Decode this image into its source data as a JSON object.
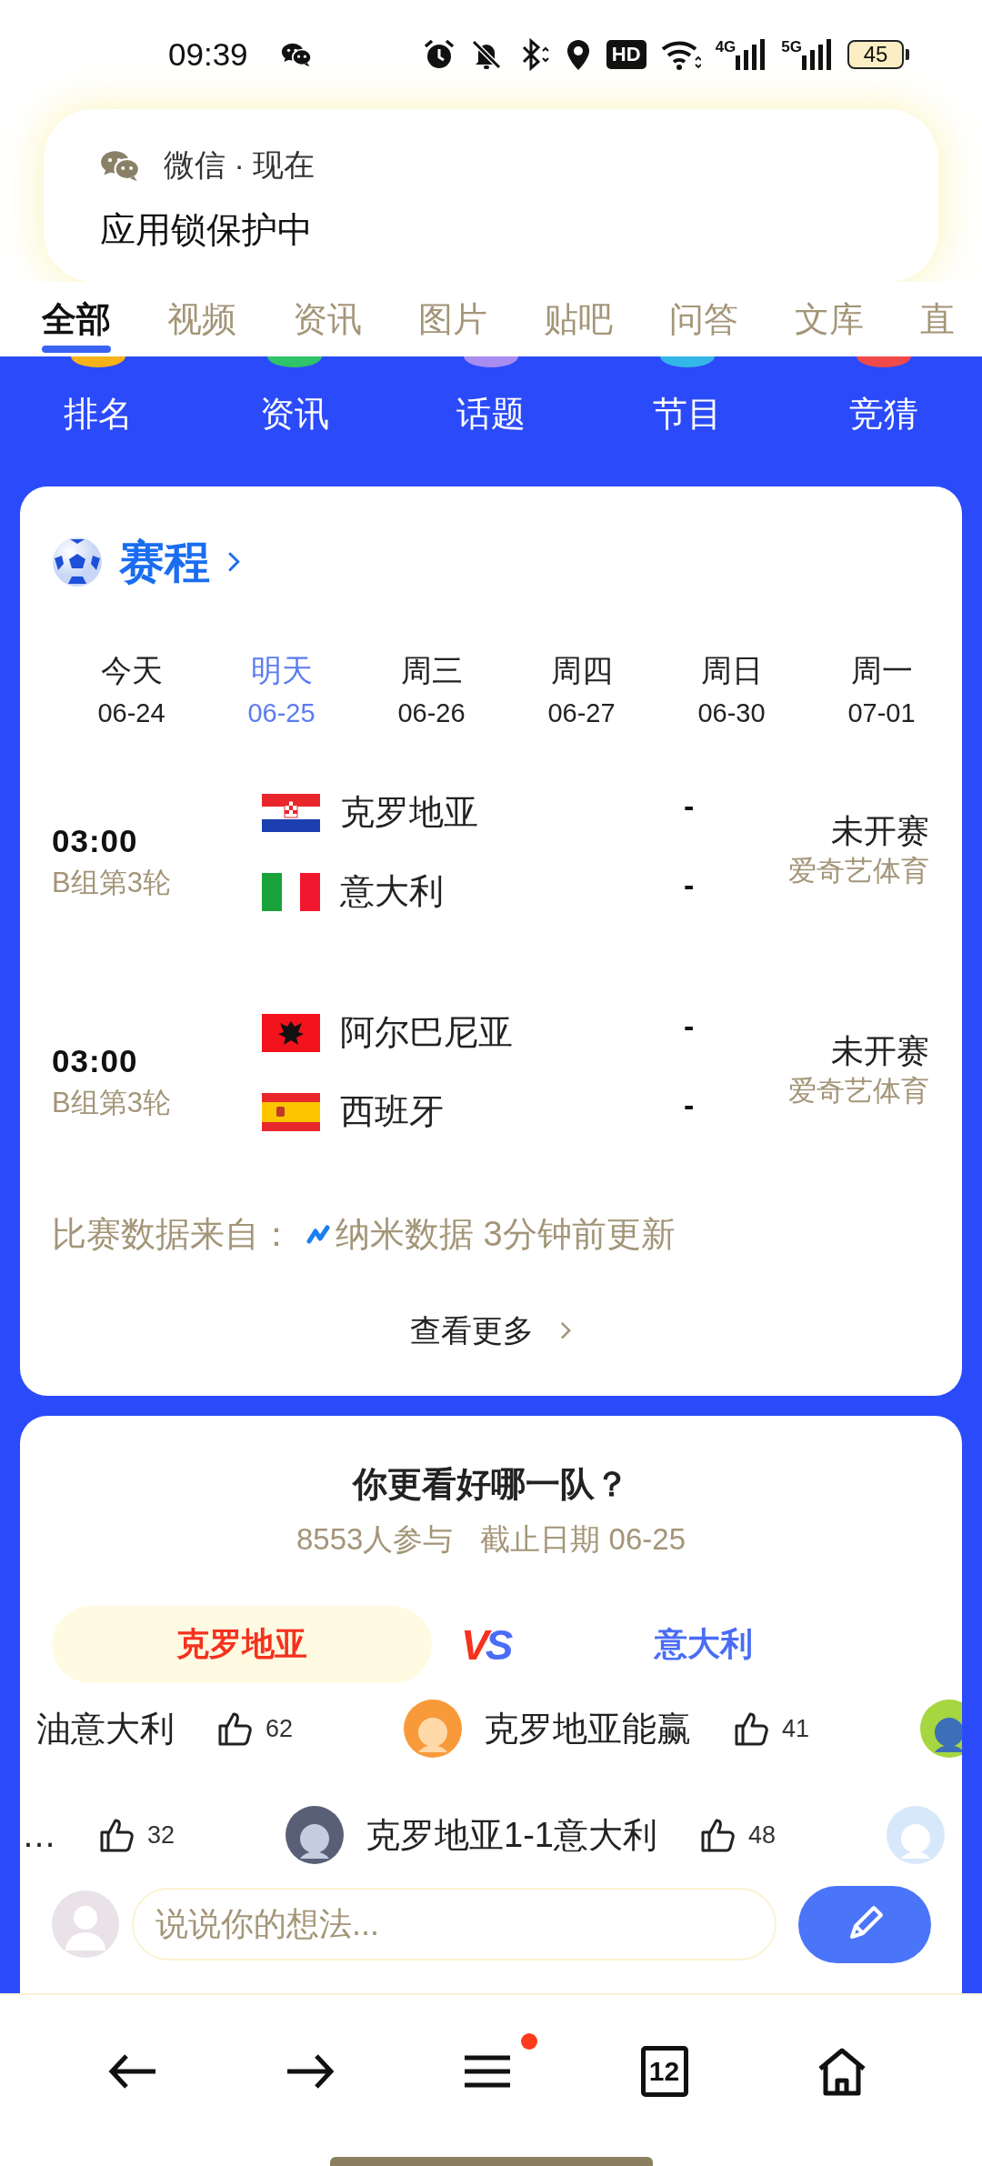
{
  "status_bar": {
    "time": "09:39",
    "indicators": [
      {
        "kind": "alarm"
      },
      {
        "kind": "mute"
      },
      {
        "kind": "bluetooth"
      },
      {
        "kind": "location"
      },
      {
        "kind": "hd",
        "label": "HD"
      },
      {
        "kind": "wifi"
      },
      {
        "kind": "signal",
        "label": "4G"
      },
      {
        "kind": "signal",
        "label": "5G"
      }
    ],
    "battery": "45"
  },
  "notification": {
    "header": "微信 · 现在",
    "message": "应用锁保护中"
  },
  "search_tabs": [
    {
      "label": "全部",
      "selected": true
    },
    {
      "label": "视频",
      "selected": false
    },
    {
      "label": "资讯",
      "selected": false
    },
    {
      "label": "图片",
      "selected": false
    },
    {
      "label": "贴吧",
      "selected": false
    },
    {
      "label": "问答",
      "selected": false
    },
    {
      "label": "文库",
      "selected": false
    },
    {
      "label": "直",
      "selected": false
    }
  ],
  "categories": [
    {
      "label": "排名",
      "color": "#f7b21a"
    },
    {
      "label": "资讯",
      "color": "#2fc46a"
    },
    {
      "label": "话题",
      "color": "#a98cf0"
    },
    {
      "label": "节目",
      "color": "#35b6e8"
    },
    {
      "label": "竞猜",
      "color": "#f04a4a"
    }
  ],
  "schedule": {
    "title": "赛程",
    "dates": [
      {
        "day": "今天",
        "date": "06-24",
        "selected": false
      },
      {
        "day": "明天",
        "date": "06-25",
        "selected": true
      },
      {
        "day": "周三",
        "date": "06-26",
        "selected": false
      },
      {
        "day": "周四",
        "date": "06-27",
        "selected": false
      },
      {
        "day": "周日",
        "date": "06-30",
        "selected": false
      },
      {
        "day": "周一",
        "date": "07-01",
        "selected": false
      }
    ],
    "matches": [
      {
        "time": "03:00",
        "round": "B组第3轮",
        "status": "未开赛",
        "broadcaster": "爱奇艺体育",
        "teams": [
          {
            "name": "克罗地亚",
            "kind": "croatia",
            "score": "-"
          },
          {
            "name": "意大利",
            "kind": "italy",
            "score": "-"
          }
        ]
      },
      {
        "time": "03:00",
        "round": "B组第3轮",
        "status": "未开赛",
        "broadcaster": "爱奇艺体育",
        "teams": [
          {
            "name": "阿尔巴尼亚",
            "kind": "albania",
            "score": "-"
          },
          {
            "name": "西班牙",
            "kind": "spain",
            "score": "-"
          }
        ]
      }
    ],
    "source_label": "比赛数据来自：",
    "source": "纳米数据 3分钟前更新",
    "more": "查看更多"
  },
  "poll": {
    "title": "你更看好哪一队？",
    "participants": "8553人参与",
    "deadline": "截止日期 06-25",
    "teams": [
      "克罗地亚",
      "意大利"
    ],
    "vs": "VS",
    "comment_rows": [
      [
        {
          "avatar": false,
          "text": "油意大利",
          "likes": "62"
        },
        {
          "avatar": true,
          "text": "克罗地亚能赢",
          "likes": "41"
        },
        {
          "avatar": true
        }
      ],
      [
        {
          "avatar": false,
          "text": "…",
          "likes": "32"
        },
        {
          "avatar": true,
          "text": "克罗地亚1-1意大利",
          "likes": "48"
        },
        {
          "avatar": true
        }
      ]
    ],
    "input": {
      "placeholder": "说说你的想法..."
    }
  },
  "bottom_nav": {
    "tab_count": "12",
    "menu_badge": true
  }
}
